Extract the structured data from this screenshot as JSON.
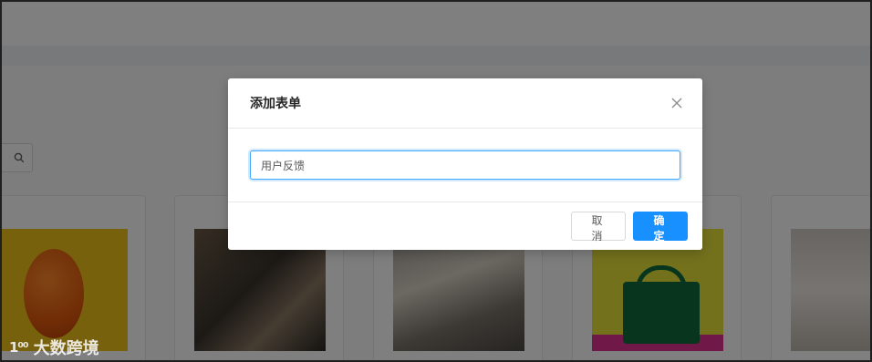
{
  "modal": {
    "title": "添加表单",
    "input_value": "用户反馈",
    "cancel_label": "取 消",
    "ok_label": "确 定"
  },
  "watermark": {
    "logo": "1⁰⁰",
    "text": "大数跨境"
  },
  "colors": {
    "primary": "#1890ff",
    "mask": "rgba(0,0,0,0.5)"
  }
}
